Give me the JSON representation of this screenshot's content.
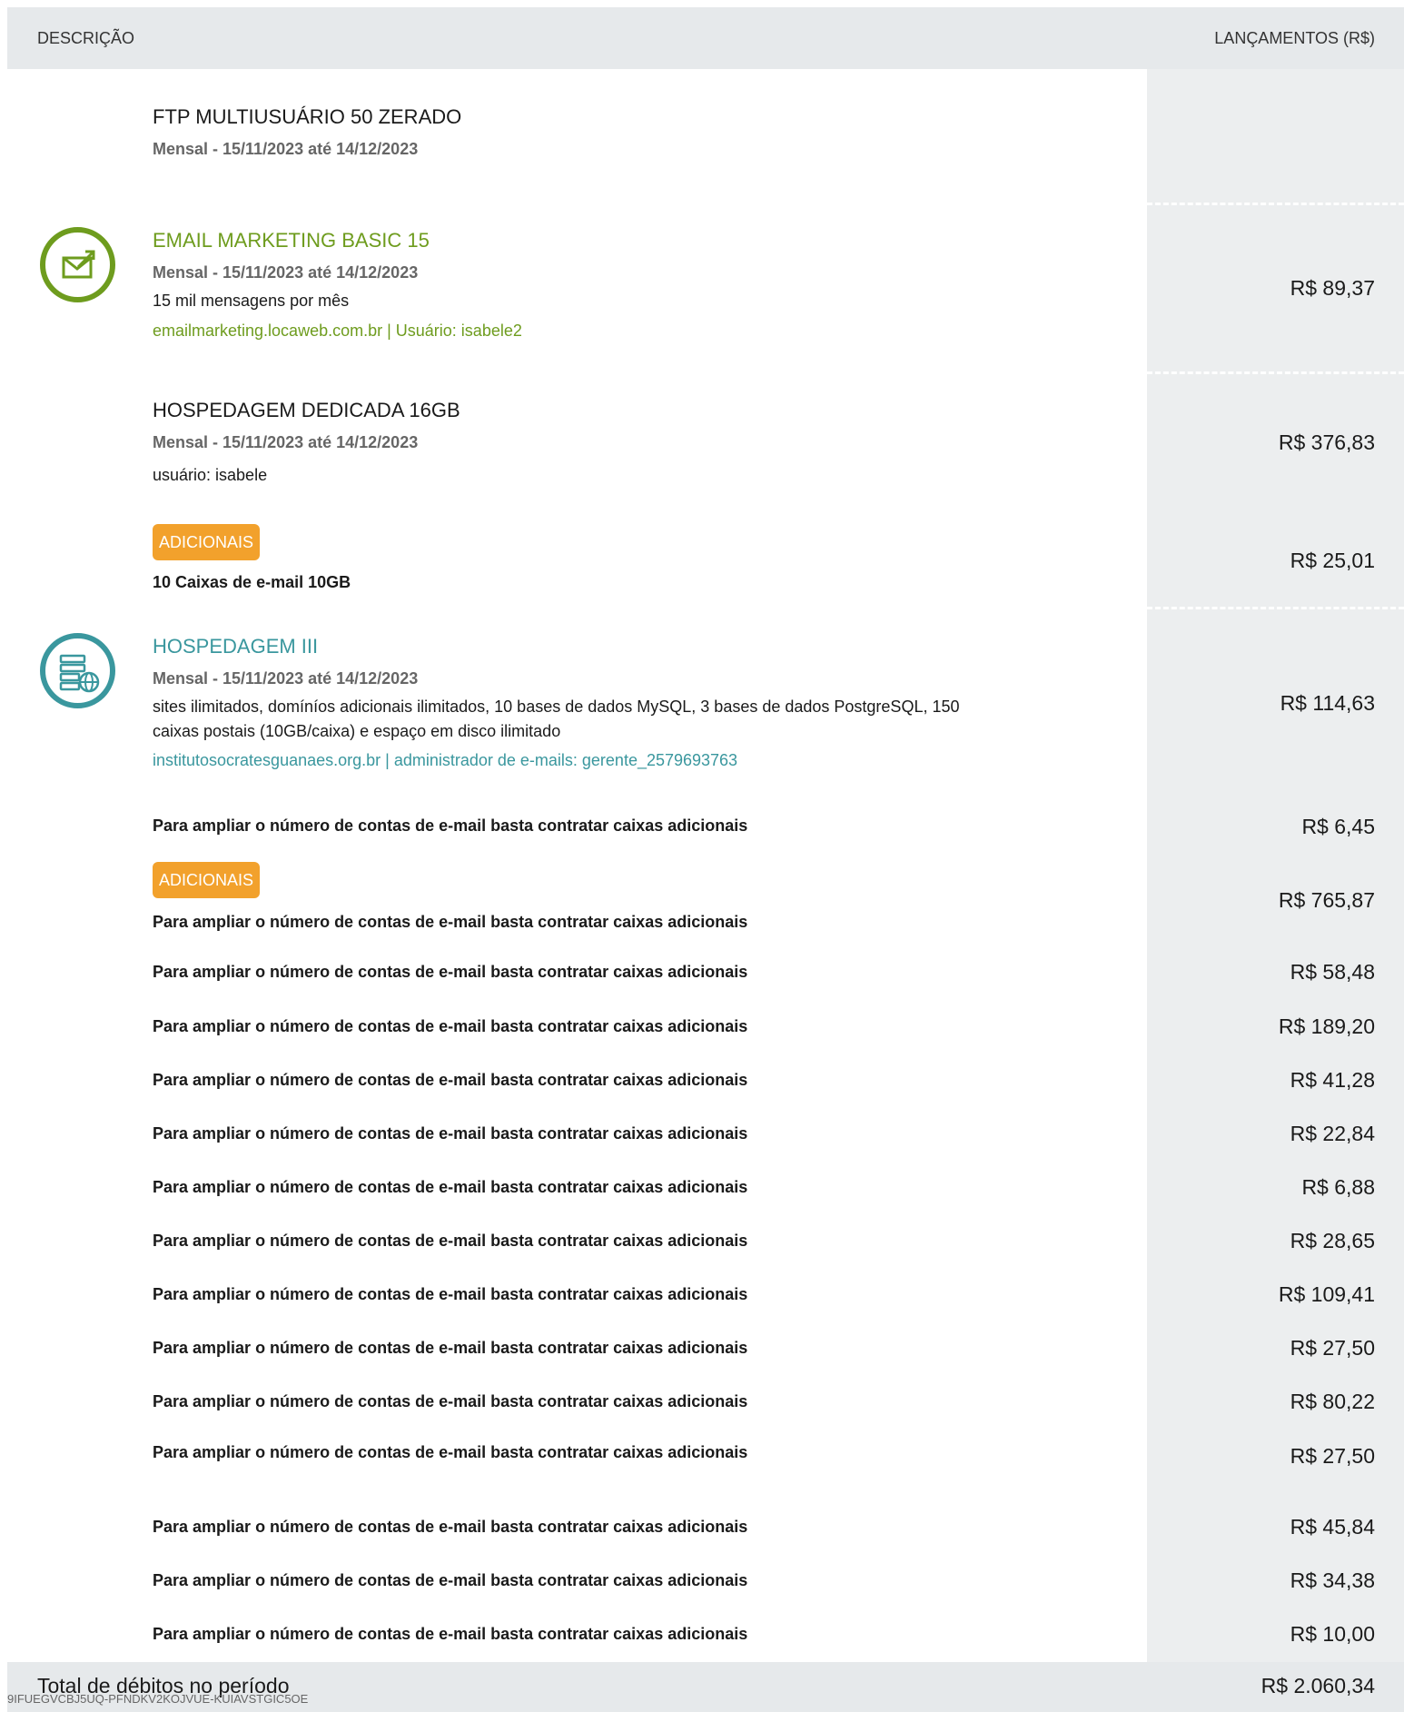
{
  "header": {
    "description": "DESCRIÇÃO",
    "amounts": "LANÇAMENTOS (R$)"
  },
  "items": {
    "ftp": {
      "title": "FTP MULTIUSUÁRIO 50 ZERADO",
      "period": "Mensal - 15/11/2023 até 14/12/2023"
    },
    "email": {
      "title": "EMAIL MARKETING BASIC 15",
      "period": "Mensal - 15/11/2023 até 14/12/2023",
      "desc": "15 mil mensagens por mês",
      "link": "emailmarketing.locaweb.com.br | Usuário: isabele2",
      "amount": "R$ 89,37",
      "icon": "envelope-arrow-icon"
    },
    "dedicated": {
      "title": "HOSPEDAGEM DEDICADA 16GB",
      "period": "Mensal - 15/11/2023 até 14/12/2023",
      "desc": "usuário: isabele",
      "amount": "R$ 376,83",
      "addon_badge": "ADICIONAIS",
      "addon_label": "10 Caixas de e-mail 10GB",
      "addon_amount": "R$ 25,01"
    },
    "hosting": {
      "title": "HOSPEDAGEM III",
      "period": "Mensal - 15/11/2023 até 14/12/2023",
      "desc": "sites ilimitados, domíníos adicionais ilimitados, 10 bases de dados MySQL, 3 bases de dados PostgreSQL, 150 caixas postais (10GB/caixa) e espaço em disco ilimitado",
      "link": "institutosocratesguanaes.org.br | administrador de e-mails: gerente_2579693763",
      "amount": "R$ 114,63",
      "icon": "server-globe-icon",
      "line1_label": "Para ampliar o número de contas de e-mail basta contratar caixas adicionais",
      "line1_amount": "R$ 6,45",
      "addon_badge": "ADICIONAIS",
      "addon_amount": "R$ 765,87"
    }
  },
  "addon_lines": [
    {
      "label": "Para ampliar o número de contas de e-mail basta contratar caixas adicionais",
      "amount": ""
    },
    {
      "label": "Para ampliar o número de contas de e-mail basta contratar caixas adicionais",
      "amount": "R$ 58,48"
    },
    {
      "label": "Para ampliar o número de contas de e-mail basta contratar caixas adicionais",
      "amount": "R$ 189,20"
    },
    {
      "label": "Para ampliar o número de contas de e-mail basta contratar caixas adicionais",
      "amount": "R$ 41,28"
    },
    {
      "label": "Para ampliar o número de contas de e-mail basta contratar caixas adicionais",
      "amount": "R$ 22,84"
    },
    {
      "label": "Para ampliar o número de contas de e-mail basta contratar caixas adicionais",
      "amount": "R$ 6,88"
    },
    {
      "label": "Para ampliar o número de contas de e-mail basta contratar caixas adicionais",
      "amount": "R$ 28,65"
    },
    {
      "label": "Para ampliar o número de contas de e-mail basta contratar caixas adicionais",
      "amount": "R$ 109,41"
    },
    {
      "label": "Para ampliar o número de contas de e-mail basta contratar caixas adicionais",
      "amount": "R$ 27,50"
    },
    {
      "label": "Para ampliar o número de contas de e-mail basta contratar caixas adicionais",
      "amount": "R$ 80,22"
    },
    {
      "label": "Para ampliar o número de contas de e-mail basta contratar caixas adicionais",
      "amount": "R$ 27,50"
    },
    {
      "label": "Para ampliar o número de contas de e-mail basta contratar caixas adicionais",
      "amount": "R$ 45,84"
    },
    {
      "label": "Para ampliar o número de contas de e-mail basta contratar caixas adicionais",
      "amount": "R$ 34,38"
    },
    {
      "label": "Para ampliar o número de contas de e-mail basta contratar caixas adicionais",
      "amount": "R$ 10,00"
    }
  ],
  "footer": {
    "total_label": "Total de débitos no período",
    "code": "9IFUEGVCBJ5UQ-PFNDKV2KOJVUE-KUIAVSTGIC5OE",
    "total_amount": "R$ 2.060,34"
  },
  "colors": {
    "green": "#6e9c1e",
    "teal": "#3a979e",
    "badge": "#f2a12c",
    "header_bg": "#e6e9eb"
  }
}
